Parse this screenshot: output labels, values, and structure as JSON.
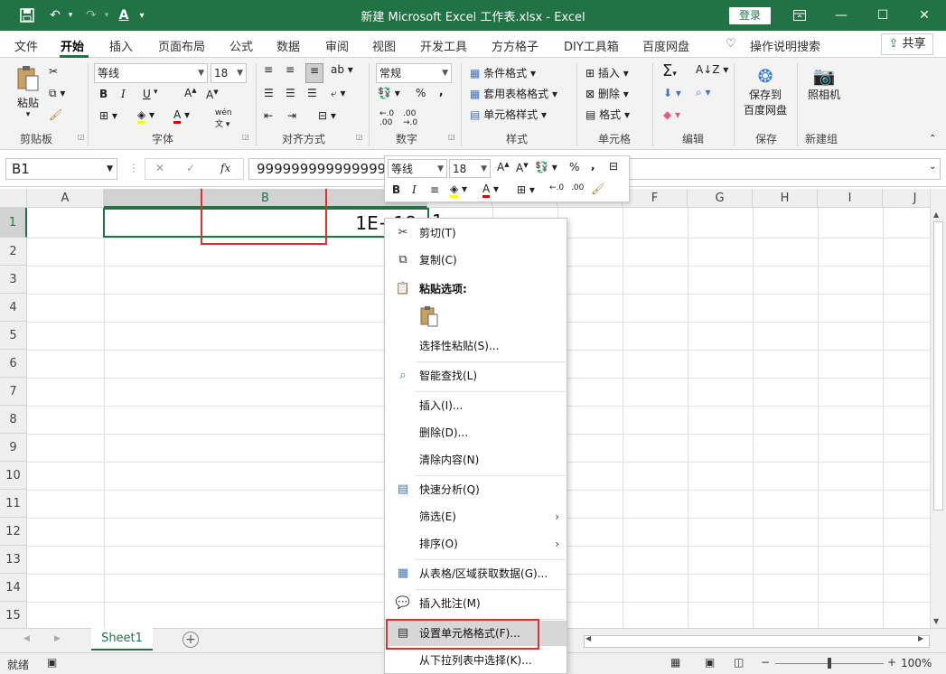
{
  "titlebar": {
    "title": "新建 Microsoft Excel 工作表.xlsx  -  Excel",
    "login": "登录",
    "bg": "#217346"
  },
  "tabs": [
    "文件",
    "开始",
    "插入",
    "页面布局",
    "公式",
    "数据",
    "审阅",
    "视图",
    "开发工具",
    "方方格子",
    "DIY工具箱",
    "百度网盘"
  ],
  "tell_me": "操作说明搜索",
  "share": "共享",
  "ribbon": {
    "clipboard": {
      "paste": "粘贴",
      "label": "剪贴板"
    },
    "font": {
      "name": "等线",
      "size": "18",
      "bold": "B",
      "italic": "I",
      "underline": "U",
      "label": "字体"
    },
    "alignment": {
      "label": "对齐方式"
    },
    "number": {
      "format": "常规",
      "label": "数字"
    },
    "styles": {
      "cond": "条件格式",
      "table": "套用表格格式",
      "cell": "单元格样式",
      "label": "样式"
    },
    "cells": {
      "insert": "插入",
      "delete": "删除",
      "format": "格式",
      "label": "单元格"
    },
    "editing": {
      "label": "编辑"
    },
    "save": {
      "line1": "保存到",
      "line2": "百度网盘",
      "label": "保存"
    },
    "camera": {
      "btn": "照相机",
      "label": "新建组"
    }
  },
  "formula_bar": {
    "name_box": "B1",
    "formula": "999999999999999"
  },
  "columns": [
    "A",
    "B",
    "C",
    "D",
    "E",
    "F",
    "G",
    "H",
    "I",
    "J"
  ],
  "rows": [
    "1",
    "2",
    "3",
    "4",
    "5",
    "6",
    "7",
    "8",
    "9",
    "10",
    "11",
    "12",
    "13",
    "14",
    "15"
  ],
  "cell_b1": "1E+18",
  "cell_c1_partial": "1",
  "mini_toolbar": {
    "font": "等线",
    "size": "18"
  },
  "context_menu": [
    {
      "label": "剪切(T)",
      "icon": "scissors-icon"
    },
    {
      "label": "复制(C)",
      "icon": "copy-icon"
    },
    {
      "label": "粘贴选项:",
      "icon": "paste-icon"
    },
    {
      "label": "选择性粘贴(S)...",
      "icon": ""
    },
    {
      "label": "智能查找(L)",
      "icon": "smart-lookup-icon"
    },
    {
      "label": "插入(I)...",
      "icon": ""
    },
    {
      "label": "删除(D)...",
      "icon": ""
    },
    {
      "label": "清除内容(N)",
      "icon": ""
    },
    {
      "label": "快速分析(Q)",
      "icon": "quick-analysis-icon"
    },
    {
      "label": "筛选(E)",
      "icon": ""
    },
    {
      "label": "排序(O)",
      "icon": ""
    },
    {
      "label": "从表格/区域获取数据(G)...",
      "icon": "table-icon"
    },
    {
      "label": "插入批注(M)",
      "icon": "comment-icon"
    },
    {
      "label": "设置单元格格式(F)...",
      "icon": "format-cells-icon"
    },
    {
      "label": "从下拉列表中选择(K)...",
      "icon": ""
    }
  ],
  "sheet_tab": "Sheet1",
  "status": {
    "ready": "就绪",
    "zoom": "100%"
  },
  "accent": "#217346",
  "highlight": "#e0302d"
}
